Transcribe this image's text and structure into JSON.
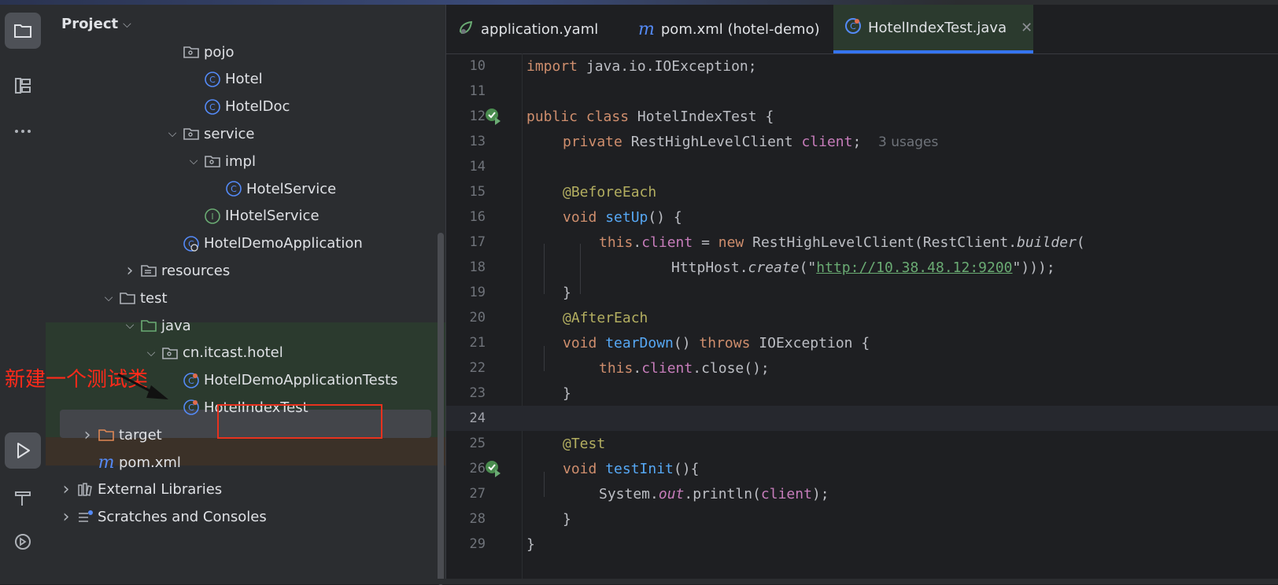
{
  "project_panel": {
    "title": "Project",
    "tree": [
      {
        "label": "pojo",
        "kind": "package",
        "indent": 6,
        "arrow": ""
      },
      {
        "label": "Hotel",
        "kind": "class",
        "indent": 7,
        "arrow": ""
      },
      {
        "label": "HotelDoc",
        "kind": "class",
        "indent": 7,
        "arrow": ""
      },
      {
        "label": "service",
        "kind": "package",
        "indent": 6,
        "arrow": "v"
      },
      {
        "label": "impl",
        "kind": "package",
        "indent": 7,
        "arrow": "v"
      },
      {
        "label": "HotelService",
        "kind": "class",
        "indent": 8,
        "arrow": ""
      },
      {
        "label": "IHotelService",
        "kind": "interface",
        "indent": 7,
        "arrow": ""
      },
      {
        "label": "HotelDemoApplication",
        "kind": "app",
        "indent": 6,
        "arrow": ""
      },
      {
        "label": "resources",
        "kind": "resfolder",
        "indent": 4,
        "arrow": ">"
      },
      {
        "label": "test",
        "kind": "folder",
        "indent": 3,
        "arrow": "v"
      },
      {
        "label": "java",
        "kind": "greenfolder",
        "indent": 4,
        "arrow": "v"
      },
      {
        "label": "cn.itcast.hotel",
        "kind": "package",
        "indent": 5,
        "arrow": "v"
      },
      {
        "label": "HotelDemoApplicationTests",
        "kind": "testclass",
        "indent": 6,
        "arrow": ""
      },
      {
        "label": "HotelIndexTest",
        "kind": "testclass",
        "indent": 6,
        "arrow": ""
      },
      {
        "label": "target",
        "kind": "orangefolder",
        "indent": 2,
        "arrow": ">"
      },
      {
        "label": "pom.xml",
        "kind": "maven",
        "indent": 2,
        "arrow": ""
      },
      {
        "label": "External Libraries",
        "kind": "library",
        "indent": 1,
        "arrow": ">"
      },
      {
        "label": "Scratches and Consoles",
        "kind": "scratch",
        "indent": 1,
        "arrow": ">"
      }
    ]
  },
  "annotation": {
    "text": "新建一个测试类"
  },
  "tabs": [
    {
      "label": "application.yaml",
      "icon": "spring-leaf-icon"
    },
    {
      "label": "pom.xml (hotel-demo)",
      "icon": "maven-icon"
    },
    {
      "label": "HotelIndexTest.java",
      "icon": "test-class-icon",
      "active": true
    }
  ],
  "editor": {
    "lines": [
      {
        "n": "10"
      },
      {
        "n": "11"
      },
      {
        "n": "12"
      },
      {
        "n": "13"
      },
      {
        "n": "14"
      },
      {
        "n": "15"
      },
      {
        "n": "16"
      },
      {
        "n": "17"
      },
      {
        "n": "18"
      },
      {
        "n": "19"
      },
      {
        "n": "20"
      },
      {
        "n": "21"
      },
      {
        "n": "22"
      },
      {
        "n": "23"
      },
      {
        "n": "24"
      },
      {
        "n": "25"
      },
      {
        "n": "26"
      },
      {
        "n": "27"
      },
      {
        "n": "28"
      },
      {
        "n": "29"
      }
    ],
    "code": {
      "l10_kw": "import",
      "l10_rest": " java.io.IOException;",
      "l12_kw": "public class",
      "l12_rest": " HotelIndexTest {",
      "l13_kw": "private",
      "l13_type": " RestHighLevelClient ",
      "l13_field": "client",
      "l13_end": ";",
      "l13_hint": "3 usages",
      "l15": "@BeforeEach",
      "l16_kw": "void",
      "l16_fn": "setUp",
      "l16_end": "() {",
      "l17_this": "this",
      "l17_dot": ".",
      "l17_field": "client",
      "l17_eq": " = ",
      "l17_new": "new",
      "l17_rest": " RestHighLevelClient(RestClient.",
      "l17_builder": "builder",
      "l17_paren": "(",
      "l18_pre": "HttpHost.",
      "l18_create": "create",
      "l18_q1": "(\"",
      "l18_url": "http://10.38.48.12:9200",
      "l18_q2": "\")));",
      "l19": "}",
      "l20": "@AfterEach",
      "l21_kw": "void",
      "l21_fn": "tearDown",
      "l21_mid": "() ",
      "l21_throws": "throws",
      "l21_rest": " IOException {",
      "l22_this": "this",
      "l22_dot": ".",
      "l22_field": "client",
      "l22_rest": ".close();",
      "l23": "}",
      "l25": "@Test",
      "l26_kw": "void",
      "l26_fn": "testInit",
      "l26_end": "(){",
      "l27_pre": "System.",
      "l27_out": "out",
      "l27_mid": ".println(",
      "l27_field": "client",
      "l27_end": ");",
      "l28": "}",
      "l29": "}"
    }
  },
  "colors": {
    "keyword": "#cf8e6d",
    "field": "#c77dbb",
    "function": "#56a8f5",
    "annotation": "#b3ae60",
    "string": "#6aab73",
    "accent": "#3574f0",
    "callout": "#e8321e"
  }
}
